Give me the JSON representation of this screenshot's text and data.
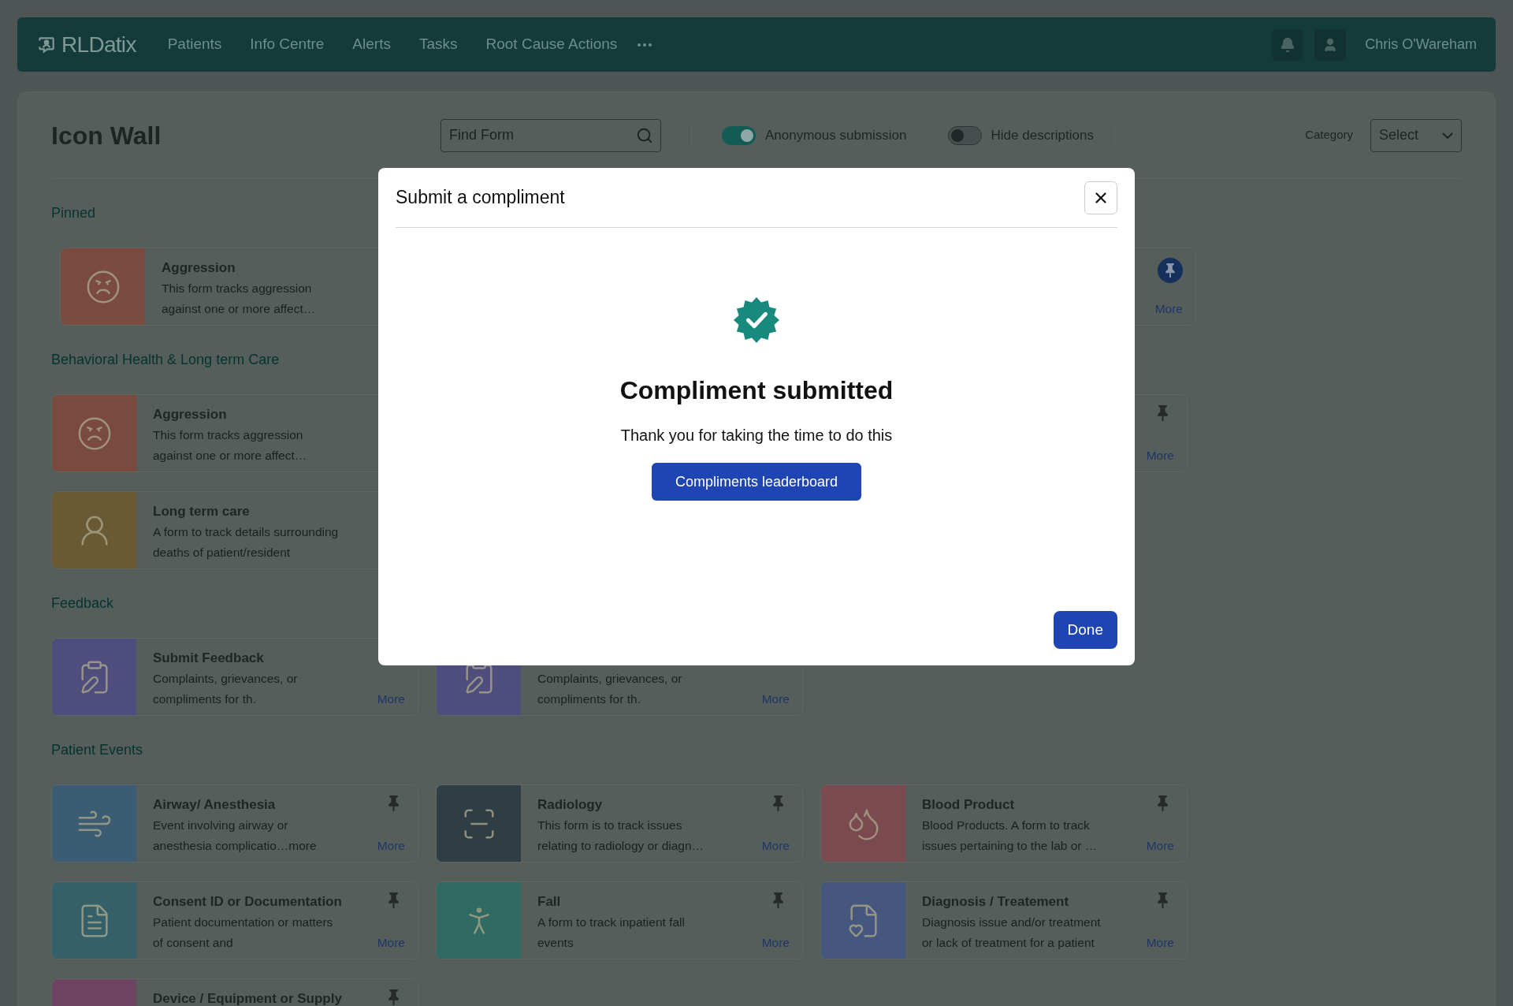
{
  "header": {
    "brand": "RLDatix",
    "nav": [
      "Patients",
      "Info Centre",
      "Alerts",
      "Tasks",
      "Root Cause Actions"
    ],
    "user": "Chris O'Wareham"
  },
  "toolbar": {
    "title": "Icon Wall",
    "search": {
      "placeholder": "Find Form"
    },
    "toggles": [
      {
        "label": "Anonymous submission",
        "on": true
      },
      {
        "label": "Hide descriptions",
        "on": false
      }
    ],
    "category": {
      "label": "Category",
      "value": "Select"
    }
  },
  "sections": [
    {
      "title": "Pinned",
      "cards": [
        {
          "title": "Aggression",
          "description_lines": [
            "This form tracks aggression",
            "against one or more affect…"
          ],
          "color": "#7c4b40"
        },
        {
          "pinned": true,
          "more": "More"
        }
      ]
    },
    {
      "title": "Behavioral Health & Long term Care",
      "cards": [
        {
          "title": "Aggression",
          "description_lines": [
            "This form tracks aggression",
            "against one or more affect…"
          ],
          "color": "#7a4a3f"
        },
        {
          "pinned": false,
          "more": "More"
        },
        {
          "title": "Long term care",
          "description_lines": [
            "A form to track details surrounding",
            "deaths of patient/resident"
          ],
          "color": "#6a5a33"
        }
      ]
    },
    {
      "title": "Feedback",
      "cards": [
        {
          "title": "Submit Feedback",
          "description_lines": [
            "Complaints, grievances, or",
            "compliments for th."
          ],
          "more": "More",
          "color": "#4e4d7d"
        },
        {
          "description_lines": [
            "Complaints, grievances, or",
            "compliments for th."
          ],
          "more": "More",
          "color": "#4e4d7d"
        }
      ]
    },
    {
      "title": "Patient Events",
      "cards": [
        {
          "title": "Airway/ Anesthesia",
          "description_lines": [
            "Event involving airway or",
            "anesthesia complicatio…more"
          ],
          "more": "More",
          "pinned": false,
          "color": "#3b5c73"
        },
        {
          "title": "Radiology",
          "description_lines": [
            "This form is to track issues",
            "relating to radiology or diagn…"
          ],
          "more": "More",
          "pinned": false,
          "color": "#2f3e44"
        },
        {
          "title": "Blood Product",
          "description_lines": [
            "Blood Products. A form to track",
            "issues pertaining to the lab or …"
          ],
          "more": "More",
          "pinned": false,
          "color": "#7a4a50"
        },
        {
          "title": "Consent ID or Documentation",
          "description_lines": [
            "Patient documentation or matters",
            "of consent and"
          ],
          "more": "More",
          "pinned": false,
          "color": "#34606a"
        },
        {
          "title": "Fall",
          "description_lines": [
            "A form to track inpatient fall",
            "events"
          ],
          "more": "More",
          "pinned": false,
          "color": "#2f6b62"
        },
        {
          "title": "Diagnosis / Treatement",
          "description_lines": [
            "Diagnosis issue and/or treatment",
            "or lack of treatment for a patient"
          ],
          "more": "More",
          "pinned": false,
          "color": "#46577f"
        },
        {
          "title": "Device / Equipment or Supply",
          "pinned": false,
          "color": "#6d4561"
        }
      ]
    }
  ],
  "dialog": {
    "title": "Submit a compliment",
    "heading": "Compliment submitted",
    "message": "Thank you for taking the time to do this",
    "action": "Compliments leaderboard",
    "done": "Done"
  }
}
